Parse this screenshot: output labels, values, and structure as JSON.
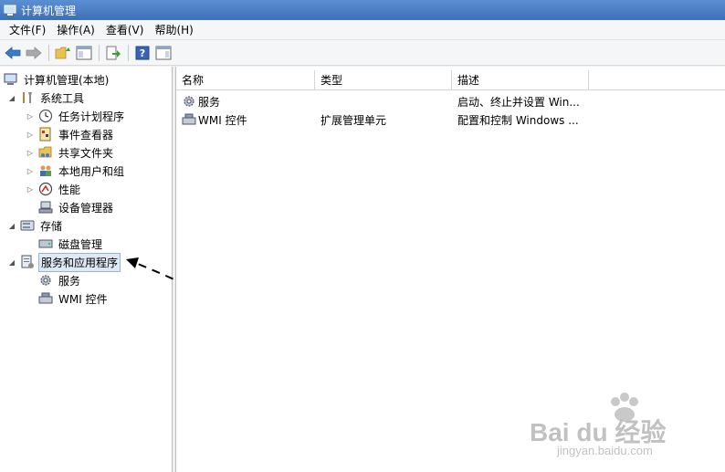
{
  "window": {
    "title": "计算机管理"
  },
  "menu": [
    "文件(F)",
    "操作(A)",
    "查看(V)",
    "帮助(H)"
  ],
  "toolbar": {
    "buttons": [
      "back-arrow-icon",
      "forward-arrow-icon",
      "up-folder-icon",
      "show-hide-tree-icon",
      "export-list-icon",
      "help-icon",
      "show-hide-action-pane-icon"
    ]
  },
  "tree": {
    "root": "计算机管理(本地)",
    "system_tools": "系统工具",
    "task_scheduler": "任务计划程序",
    "event_viewer": "事件查看器",
    "shared_folders": "共享文件夹",
    "local_users": "本地用户和组",
    "performance": "性能",
    "device_manager": "设备管理器",
    "storage": "存储",
    "disk_management": "磁盘管理",
    "services_apps": "服务和应用程序",
    "services": "服务",
    "wmi": "WMI 控件"
  },
  "list": {
    "columns": {
      "name": "名称",
      "type": "类型",
      "desc": "描述"
    },
    "rows": [
      {
        "name": "服务",
        "type": "",
        "desc": "启动、终止并设置 Win..."
      },
      {
        "name": "WMI 控件",
        "type": "扩展管理单元",
        "desc": "配置和控制 Windows ..."
      }
    ]
  },
  "watermark": {
    "brand": "Bai du 经验",
    "url": "jingyan.baidu.com"
  },
  "colors": {
    "title_bar": "#3d6fb6",
    "selection": "#dfe8f5"
  }
}
